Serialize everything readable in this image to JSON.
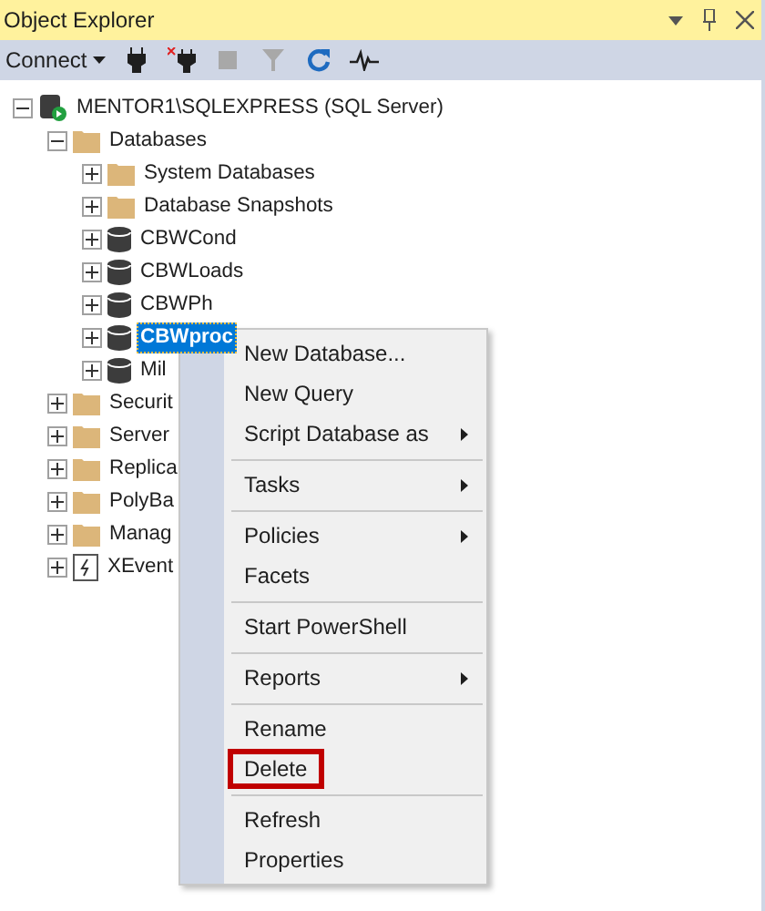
{
  "panel": {
    "title": "Object Explorer"
  },
  "toolbar": {
    "connect": "Connect",
    "tools": [
      {
        "kind": "connect",
        "disabled": false
      },
      {
        "kind": "disconnect",
        "disabled": false
      },
      {
        "kind": "stop",
        "disabled": true
      },
      {
        "kind": "filter",
        "disabled": true
      },
      {
        "kind": "refresh",
        "disabled": false
      },
      {
        "kind": "activity",
        "disabled": false
      }
    ]
  },
  "tree": [
    {
      "label": "MENTOR1\\SQLEXPRESS (SQL Server)",
      "kind": "server",
      "expanded": true,
      "selected": false,
      "children": [
        {
          "label": "Databases",
          "kind": "folder",
          "expanded": true,
          "selected": false,
          "children": [
            {
              "label": "System Databases",
              "kind": "folder",
              "expanded": false,
              "selected": false
            },
            {
              "label": "Database Snapshots",
              "kind": "folder",
              "expanded": false,
              "selected": false
            },
            {
              "label": "CBWCond",
              "kind": "database",
              "expanded": false,
              "selected": false
            },
            {
              "label": "CBWLoads",
              "kind": "database",
              "expanded": false,
              "selected": false
            },
            {
              "label": "CBWPh",
              "kind": "database",
              "expanded": false,
              "selected": false
            },
            {
              "label": "CBWproc",
              "kind": "database",
              "expanded": false,
              "selected": true
            },
            {
              "label": "Mil",
              "kind": "database",
              "expanded": false,
              "selected": false
            }
          ]
        },
        {
          "label": "Securit",
          "kind": "folder",
          "expanded": false,
          "selected": false
        },
        {
          "label": "Server",
          "kind": "folder",
          "expanded": false,
          "selected": false
        },
        {
          "label": "Replica",
          "kind": "folder",
          "expanded": false,
          "selected": false
        },
        {
          "label": "PolyBa",
          "kind": "folder",
          "expanded": false,
          "selected": false
        },
        {
          "label": "Manag",
          "kind": "folder",
          "expanded": false,
          "selected": false
        },
        {
          "label": "XEvent",
          "kind": "xevent",
          "expanded": false,
          "selected": false
        }
      ]
    }
  ],
  "context_menu": [
    {
      "kind": "item",
      "label": "New Database...",
      "submenu": false,
      "outlined": false
    },
    {
      "kind": "item",
      "label": "New Query",
      "submenu": false,
      "outlined": false
    },
    {
      "kind": "item",
      "label": "Script Database as",
      "submenu": true,
      "outlined": false
    },
    {
      "kind": "separator"
    },
    {
      "kind": "item",
      "label": "Tasks",
      "submenu": true,
      "outlined": false
    },
    {
      "kind": "separator"
    },
    {
      "kind": "item",
      "label": "Policies",
      "submenu": true,
      "outlined": false
    },
    {
      "kind": "item",
      "label": "Facets",
      "submenu": false,
      "outlined": false
    },
    {
      "kind": "separator"
    },
    {
      "kind": "item",
      "label": "Start PowerShell",
      "submenu": false,
      "outlined": false
    },
    {
      "kind": "separator"
    },
    {
      "kind": "item",
      "label": "Reports",
      "submenu": true,
      "outlined": false
    },
    {
      "kind": "separator"
    },
    {
      "kind": "item",
      "label": "Rename",
      "submenu": false,
      "outlined": false
    },
    {
      "kind": "item",
      "label": "Delete",
      "submenu": false,
      "outlined": true
    },
    {
      "kind": "separator"
    },
    {
      "kind": "item",
      "label": "Refresh",
      "submenu": false,
      "outlined": false
    },
    {
      "kind": "item",
      "label": "Properties",
      "submenu": false,
      "outlined": false
    }
  ]
}
